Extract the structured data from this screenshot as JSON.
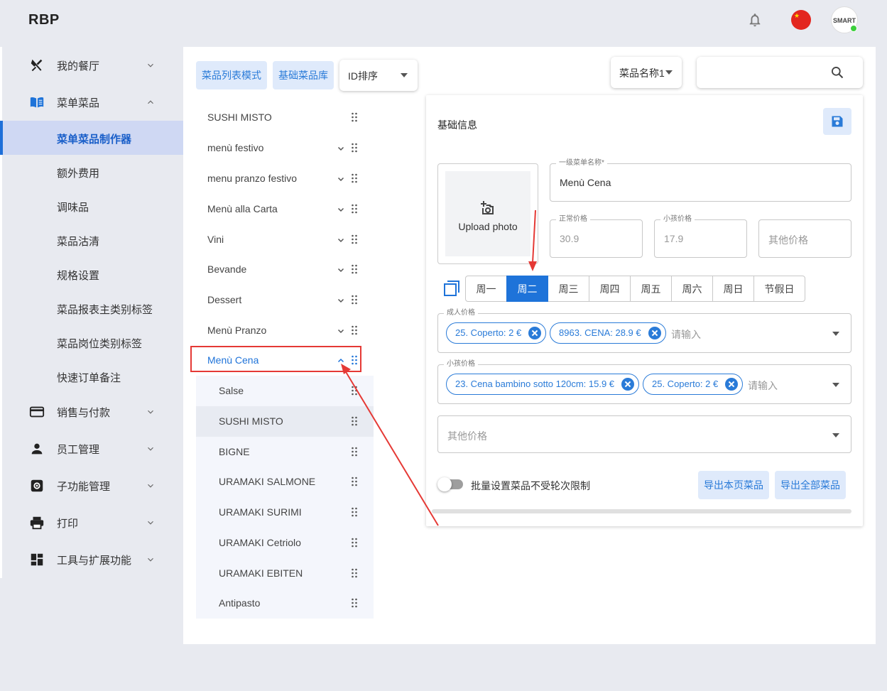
{
  "app": {
    "logo": "RBP"
  },
  "sidebar": {
    "groups": [
      {
        "label": "我的餐厅",
        "icon": "utensils-icon",
        "expanded": false
      },
      {
        "label": "菜单菜品",
        "icon": "menu-book-icon",
        "expanded": true
      },
      {
        "label": "销售与付款",
        "icon": "credit-card-icon",
        "expanded": false
      },
      {
        "label": "员工管理",
        "icon": "person-icon",
        "expanded": false
      },
      {
        "label": "子功能管理",
        "icon": "gear-icon",
        "expanded": false
      },
      {
        "label": "打印",
        "icon": "printer-icon",
        "expanded": false
      },
      {
        "label": "工具与扩展功能",
        "icon": "dashboard-icon",
        "expanded": false
      }
    ],
    "subitems": [
      {
        "label": "菜单菜品制作器",
        "active": true
      },
      {
        "label": "额外费用"
      },
      {
        "label": "调味品"
      },
      {
        "label": "菜品沽清"
      },
      {
        "label": "规格设置"
      },
      {
        "label": "菜品报表主类别标签"
      },
      {
        "label": "菜品岗位类别标签"
      },
      {
        "label": "快速订单备注"
      }
    ]
  },
  "toolbar": {
    "list_mode": "菜品列表模式",
    "base_library": "基础菜品库",
    "sort_select": "ID排序",
    "name_select": "菜品名称1",
    "search_value": ""
  },
  "tree": {
    "items": [
      {
        "label": "SUSHI MISTO",
        "chevron": false
      },
      {
        "label": "menù festivo",
        "chevron": true
      },
      {
        "label": "menu pranzo festivo",
        "chevron": true
      },
      {
        "label": "Menù alla Carta",
        "chevron": true
      },
      {
        "label": "Vini",
        "chevron": true
      },
      {
        "label": "Bevande",
        "chevron": true
      },
      {
        "label": "Dessert",
        "chevron": true
      },
      {
        "label": "Menù Pranzo",
        "chevron": true
      },
      {
        "label": "Menù Cena",
        "chevron": true,
        "selected": true
      }
    ],
    "children": [
      {
        "label": "Salse"
      },
      {
        "label": "SUSHI MISTO"
      },
      {
        "label": "BIGNE"
      },
      {
        "label": "URAMAKI SALMONE"
      },
      {
        "label": "URAMAKI SURIMI"
      },
      {
        "label": "URAMAKI Cetriolo"
      },
      {
        "label": "URAMAKI EBITEN"
      },
      {
        "label": "Antipasto"
      }
    ]
  },
  "form": {
    "section_title": "基础信息",
    "upload_label": "Upload photo",
    "first_menu_name_label": "一级菜单名称*",
    "first_menu_name_value": "Menù Cena",
    "normal_price_label": "正常价格",
    "normal_price_value": "30.9",
    "child_price_label": "小孩价格",
    "child_price_value": "17.9",
    "other_price_placeholder": "其他价格",
    "days": [
      "周一",
      "周二",
      "周三",
      "周四",
      "周五",
      "周六",
      "周日",
      "节假日"
    ],
    "active_day": "周二",
    "adult_price_label": "成人价格",
    "adult_chips": [
      "25. Coperto: 2 €",
      "8963. CENA: 28.9 €"
    ],
    "child_price_field_label": "小孩价格",
    "child_chips": [
      "23. Cena bambino sotto 120cm: 15.9 €",
      "25. Coperto: 2 €"
    ],
    "chip_input_placeholder": "请输入",
    "other_price_select": "其他价格",
    "toggle_label": "批量设置菜品不受轮次限制",
    "export_page": "导出本页菜品",
    "export_all": "导出全部菜品"
  },
  "colors": {
    "accent": "#1e73d9",
    "light_button": "#dfeafb",
    "annotation_red": "#e53935"
  }
}
